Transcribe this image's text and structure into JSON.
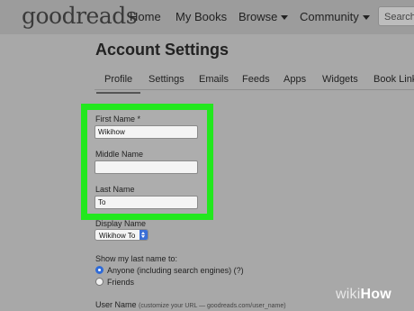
{
  "header": {
    "logo": "goodreads",
    "nav": [
      {
        "label": "Home"
      },
      {
        "label": "My Books"
      },
      {
        "label": "Browse"
      },
      {
        "label": "Community"
      }
    ],
    "search_placeholder": "Search"
  },
  "page": {
    "title": "Account Settings",
    "tabs": [
      "Profile",
      "Settings",
      "Emails",
      "Feeds",
      "Apps",
      "Widgets",
      "Book Links"
    ],
    "active_tab": "Profile"
  },
  "form": {
    "first_name": {
      "label": "First Name *",
      "value": "Wikihow"
    },
    "middle_name": {
      "label": "Middle Name",
      "value": ""
    },
    "last_name": {
      "label": "Last Name",
      "value": "To"
    },
    "display_name": {
      "label": "Display Name",
      "value": "Wikihow To"
    },
    "show_last_name": {
      "label": "Show my last name to:",
      "options": [
        {
          "label": "Anyone (including search engines) (?)",
          "selected": true
        },
        {
          "label": "Friends",
          "selected": false
        }
      ]
    },
    "user_name": {
      "label": "User Name",
      "hint": "(customize your URL — goodreads.com/user_name)"
    }
  },
  "highlight_color": "#22e81e",
  "watermark": {
    "prefix": "wiki",
    "suffix": "How"
  }
}
